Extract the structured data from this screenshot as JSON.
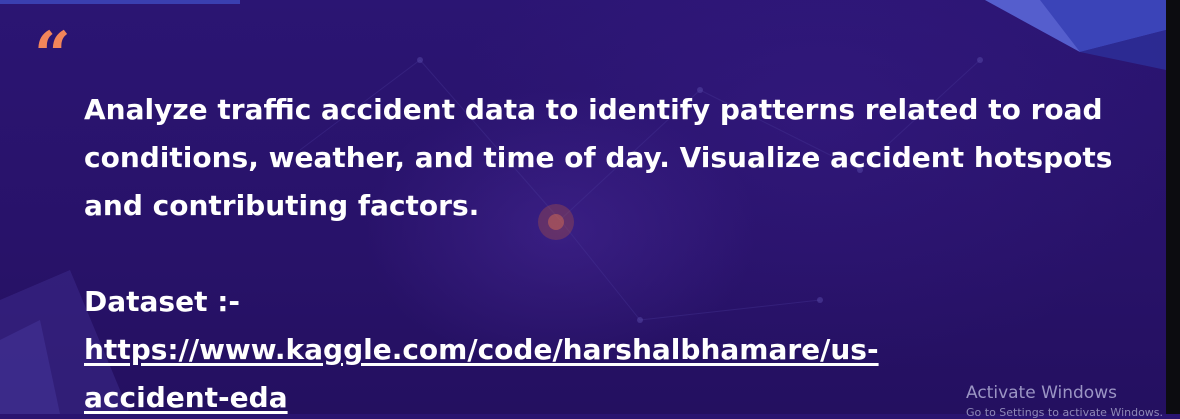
{
  "slide": {
    "quote_mark": "“",
    "paragraph": "Analyze traffic accident data to identify patterns related to road conditions, weather, and time of day. Visualize accident hotspots and contributing factors.",
    "dataset_label": "Dataset :-",
    "dataset_link_line1": "https://www.kaggle.com/code/harshalbhamare/us-",
    "dataset_link_line2": "accident-eda"
  },
  "watermark": {
    "title": "Activate Windows",
    "subtitle": "Go to Settings to activate Windows."
  },
  "colors": {
    "background": "#2a1470",
    "quote_accent": "#f2855a",
    "text": "#ffffff",
    "shape_blue": "#3a3fb0"
  }
}
